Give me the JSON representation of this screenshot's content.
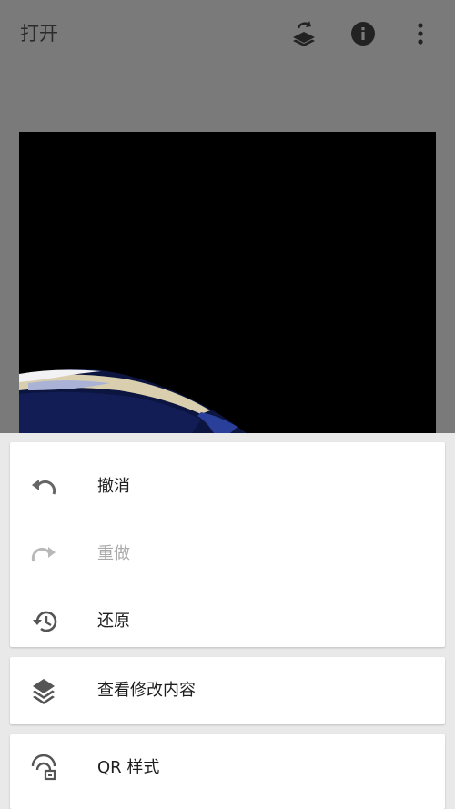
{
  "header": {
    "title": "打开",
    "icons": [
      "looks-stack-icon",
      "info-icon",
      "more-vert-icon"
    ]
  },
  "menu": {
    "group1": [
      {
        "label": "撤消",
        "icon": "undo-icon",
        "enabled": true
      },
      {
        "label": "重做",
        "icon": "redo-icon",
        "enabled": false
      },
      {
        "label": "还原",
        "icon": "history-icon",
        "enabled": true
      }
    ],
    "group2": [
      {
        "label": "查看修改内容",
        "icon": "layers-icon",
        "enabled": true
      }
    ],
    "group3": [
      {
        "label": "QR 样式",
        "icon": "qr-look-icon",
        "enabled": true
      }
    ]
  },
  "colors": {
    "dim_background": "#7a7a7a",
    "sheet_background": "#e9e9e9",
    "card": "#ffffff",
    "text": "#1e1e1e",
    "disabled_text": "#a8a8a8"
  }
}
